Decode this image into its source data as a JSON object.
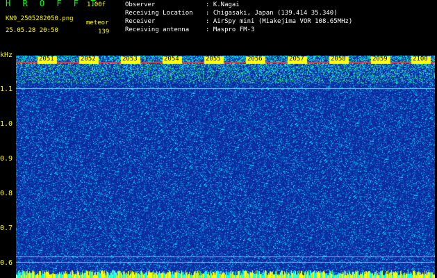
{
  "header": {
    "app_title": "H R O F F T",
    "version": "1.00f",
    "file_name": "KN9_2505282050.png",
    "mode": "meteor",
    "datetime": "25.05.28 20:50",
    "count": "139"
  },
  "info": [
    {
      "label": "Observer",
      "value": ": K.Nagai"
    },
    {
      "label": "Receiving Location",
      "value": ": Chigasaki, Japan (139.414 35.340)"
    },
    {
      "label": "Receiver",
      "value": ": AirSpy mini (Miakejima VOR 108.65MHz)"
    },
    {
      "label": "Receiving antenna",
      "value": ": Maspro FM-3"
    }
  ],
  "axis": {
    "unit": "kHz",
    "y_labels": [
      "1.1",
      "1.0",
      "0.9",
      "0.8",
      "0.7",
      "0.6"
    ]
  },
  "time_marks": [
    "2051",
    "2052",
    "2053",
    "2054",
    "2055",
    "2056",
    "2057",
    "2058",
    "2059",
    "2100"
  ],
  "colors": {
    "background": "#000000",
    "spectrum_low": "#0a2a9e",
    "spectrum_high": "#00e0ff",
    "accent": "#ffff00",
    "title": "#00ff00"
  }
}
